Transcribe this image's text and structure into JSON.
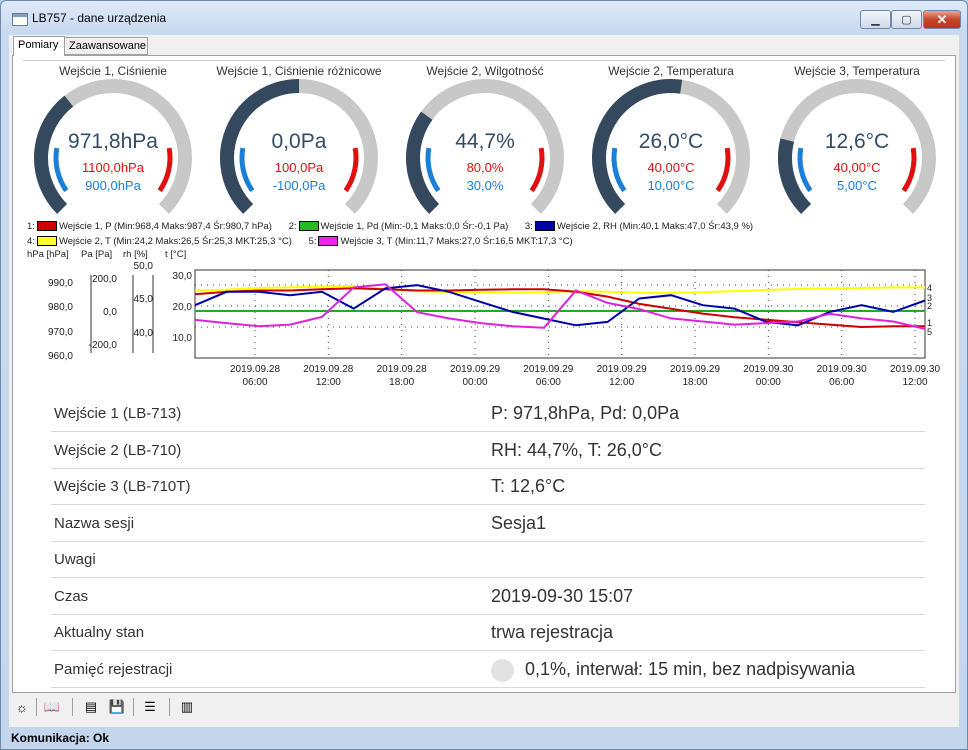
{
  "window": {
    "title": "LB757 - dane urządzenia",
    "min_glyph": "▁",
    "max_glyph": "▢",
    "close_glyph": "✕"
  },
  "tabs": [
    {
      "label": "Pomiary"
    },
    {
      "label": "Zaawansowane"
    }
  ],
  "gauges": [
    {
      "title": "Wejście 1, Ciśnienie",
      "value": "971,8hPa",
      "max": "1100,0hPa",
      "min": "900,0hPa",
      "fraction": 0.36
    },
    {
      "title": "Wejście 1, Ciśnienie różnicowe",
      "value": "0,0Pa",
      "max": "100,0Pa",
      "min": "-100,0Pa",
      "fraction": 0.5
    },
    {
      "title": "Wejście 2, Wilgotność",
      "value": "44,7%",
      "max": "80,0%",
      "min": "30,0%",
      "fraction": 0.3
    },
    {
      "title": "Wejście 2, Temperatura",
      "value": "26,0°C",
      "max": "40,00°C",
      "min": "10,00°C",
      "fraction": 0.53
    },
    {
      "title": "Wejście 3, Temperatura",
      "value": "12,6°C",
      "max": "40,00°C",
      "min": "5,00°C",
      "fraction": 0.22
    }
  ],
  "legend": [
    {
      "num": "1:",
      "text": "Wejście 1, P (Min:968,4 Maks:987,4 Śr:980,7 hPa)",
      "color": "#cc0000"
    },
    {
      "num": "2:",
      "text": "Wejście 1, Pd (Min:-0,1 Maks:0,0 Śr:-0,1 Pa)",
      "color": "#22bb22"
    },
    {
      "num": "3:",
      "text": "Wejście 2, RH (Min:40,1 Maks:47,0 Śr:43,9 %)",
      "color": "#0000aa"
    },
    {
      "num": "4:",
      "text": "Wejście 2, T (Min:24,2 Maks:26,5 Śr:25,3 MKT:25,3 °C)",
      "color": "#ffff33"
    },
    {
      "num": "5:",
      "text": "Wejście 3, T (Min:11,7 Maks:27,0 Śr:16,5 MKT:17,3 °C)",
      "color": "#ee22ee"
    }
  ],
  "chart_data": {
    "type": "line",
    "axes": [
      {
        "label": "hPa [hPa]",
        "ticks": [
          "990,0",
          "980,0",
          "970,0",
          "960,0"
        ]
      },
      {
        "label": "Pa [Pa]",
        "ticks": [
          "200,0",
          "0,0",
          "-200,0"
        ]
      },
      {
        "label": "rh [%]",
        "ticks": [
          "50,0",
          "45,0",
          "40,0"
        ]
      },
      {
        "label": "t [°C]",
        "ticks": [
          "30,0",
          "20,0",
          "10,0"
        ]
      }
    ],
    "x_ticks": [
      [
        "2019.09.28",
        "06:00"
      ],
      [
        "2019.09.28",
        "12:00"
      ],
      [
        "2019.09.28",
        "18:00"
      ],
      [
        "2019.09.29",
        "00:00"
      ],
      [
        "2019.09.29",
        "06:00"
      ],
      [
        "2019.09.29",
        "12:00"
      ],
      [
        "2019.09.29",
        "18:00"
      ],
      [
        "2019.09.30",
        "00:00"
      ],
      [
        "2019.09.30",
        "06:00"
      ],
      [
        "2019.09.30",
        "12:00"
      ]
    ],
    "right_markers": [
      "4",
      "3",
      "2",
      "1",
      "5"
    ],
    "series": [
      {
        "name": "Wejście 2, T",
        "color": "#ffff00",
        "values": [
          25.0,
          25.3,
          25.8,
          26.0,
          26.3,
          26.5,
          25.5,
          24.8,
          24.5,
          24.4,
          24.3,
          24.5,
          24.8,
          24.6,
          24.3,
          24.2,
          24.5,
          24.8,
          25.2,
          25.5,
          25.6,
          25.8,
          26.0,
          26.0
        ]
      },
      {
        "name": "Wejście 1, Pd",
        "color": "#22aa22",
        "values": [
          -0.1,
          -0.1,
          -0.1,
          -0.1,
          -0.1,
          -0.1,
          -0.1,
          -0.1,
          -0.1,
          -0.1,
          -0.1,
          -0.1,
          -0.1,
          -0.1,
          -0.1,
          -0.1,
          -0.1,
          -0.1,
          -0.1,
          -0.1,
          -0.1,
          -0.1,
          0.0,
          0.0
        ]
      },
      {
        "name": "Wejście 1, P",
        "color": "#cc0000",
        "values": [
          985.0,
          986.0,
          986.5,
          986.5,
          987.0,
          987.4,
          987.0,
          986.5,
          986.5,
          986.8,
          987.0,
          987.0,
          986.0,
          984.0,
          981.0,
          979.0,
          977.0,
          975.5,
          974.5,
          973.5,
          972.5,
          971.5,
          971.8,
          971.8
        ]
      },
      {
        "name": "Wejście 2, RH",
        "color": "#0000aa",
        "values": [
          44.0,
          46.0,
          46.0,
          45.5,
          46.0,
          43.5,
          46.5,
          47.0,
          46.0,
          44.5,
          43.0,
          42.0,
          41.0,
          41.5,
          45.0,
          45.5,
          44.0,
          43.5,
          41.5,
          41.0,
          43.0,
          44.0,
          43.0,
          44.7
        ]
      },
      {
        "name": "Wejście 3, T",
        "color": "#dd22dd",
        "values": [
          15.5,
          14.5,
          13.5,
          14.0,
          16.5,
          26.0,
          27.0,
          18.0,
          16.0,
          14.5,
          13.5,
          13.0,
          25.0,
          21.0,
          19.0,
          16.0,
          15.0,
          14.0,
          14.5,
          15.0,
          17.5,
          16.0,
          15.0,
          12.6
        ]
      }
    ]
  },
  "info": [
    {
      "label": "Wejście 1 (LB-713)",
      "value": "P: 971,8hPa, Pd: 0,0Pa"
    },
    {
      "label": "Wejście 2 (LB-710)",
      "value": "RH: 44,7%, T: 26,0°C"
    },
    {
      "label": "Wejście 3 (LB-710T)",
      "value": "T: 12,6°C"
    },
    {
      "label": "Nazwa sesji",
      "value": "Sesja1"
    },
    {
      "label": "Uwagi",
      "value": ""
    },
    {
      "label": "Czas",
      "value": "2019-09-30 15:07"
    },
    {
      "label": "Aktualny stan",
      "value": "trwa rejestracja"
    },
    {
      "label": "Pamięć rejestracji",
      "value": "0,1%, interwał: 15 min, bez nadpisywania",
      "fill": 0.001
    }
  ],
  "toolbar": [
    {
      "name": "settings-icon",
      "glyph": "☼"
    },
    {
      "name": "book-icon",
      "glyph": "📖"
    },
    {
      "name": "pdf-icon",
      "glyph": "▤"
    },
    {
      "name": "save-icon",
      "glyph": "💾"
    },
    {
      "name": "list-icon",
      "glyph": "☰"
    },
    {
      "name": "device-icon",
      "glyph": "▥"
    }
  ],
  "status": "Komunikacja: Ok"
}
